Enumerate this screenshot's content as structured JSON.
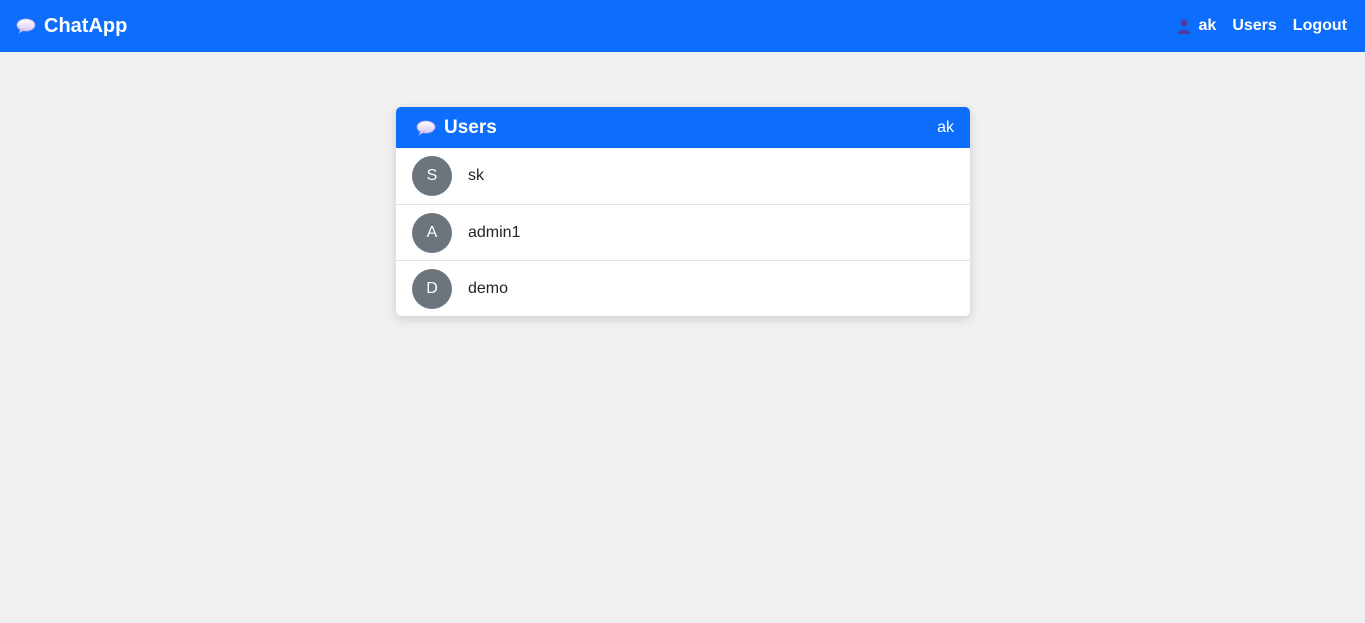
{
  "navbar": {
    "brand_label": "ChatApp",
    "brand_icon": "speech-bubble-icon",
    "current_user": "ak",
    "user_icon": "person-icon",
    "links": [
      {
        "label": "Users"
      },
      {
        "label": "Logout"
      }
    ],
    "background_color": "#0d6efd"
  },
  "card": {
    "title": "Users",
    "title_icon": "speech-bubble-icon",
    "header_user": "ak",
    "users": [
      {
        "initial": "S",
        "name": "sk"
      },
      {
        "initial": "A",
        "name": "admin1"
      },
      {
        "initial": "D",
        "name": "demo"
      }
    ],
    "avatar_color": "#6c757d"
  }
}
